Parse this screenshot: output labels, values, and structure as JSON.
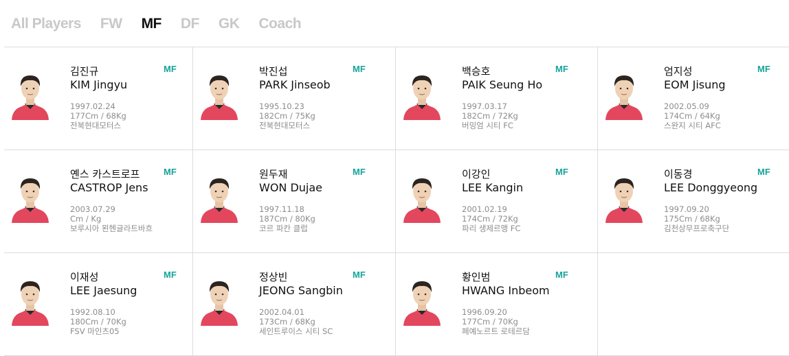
{
  "tabs": [
    "All Players",
    "FW",
    "MF",
    "DF",
    "GK",
    "Coach"
  ],
  "active_tab": "MF",
  "colors": {
    "accent": "#16a39a",
    "active_tab": "#111111",
    "inactive_tab": "#c8c8c8",
    "jersey": "#e3475d"
  },
  "players": [
    {
      "name_kr": "김진규",
      "name_en": "KIM Jingyu",
      "position": "MF",
      "birth": "1997.02.24",
      "body": "177Cm / 68Kg",
      "club": "전북현대모터스"
    },
    {
      "name_kr": "박진섭",
      "name_en": "PARK Jinseob",
      "position": "MF",
      "birth": "1995.10.23",
      "body": "182Cm / 75Kg",
      "club": "전북현대모터스"
    },
    {
      "name_kr": "백승호",
      "name_en": "PAIK Seung Ho",
      "position": "MF",
      "birth": "1997.03.17",
      "body": "182Cm / 72Kg",
      "club": "버밍엄 시티 FC"
    },
    {
      "name_kr": "엄지성",
      "name_en": "EOM Jisung",
      "position": "MF",
      "birth": "2002.05.09",
      "body": "174Cm / 64Kg",
      "club": "스완지 시티 AFC"
    },
    {
      "name_kr": "옌스 카스트로프",
      "name_en": "CASTROP Jens",
      "position": "MF",
      "birth": "2003.07.29",
      "body": "Cm / Kg",
      "club": "보루시아 묀헨글라트바흐"
    },
    {
      "name_kr": "원두재",
      "name_en": "WON Dujae",
      "position": "MF",
      "birth": "1997.11.18",
      "body": "187Cm / 80Kg",
      "club": "코르 파칸 클럽"
    },
    {
      "name_kr": "이강인",
      "name_en": "LEE Kangin",
      "position": "MF",
      "birth": "2001.02.19",
      "body": "174Cm / 72Kg",
      "club": "파리 생제르맹 FC"
    },
    {
      "name_kr": "이동경",
      "name_en": "LEE Donggyeong",
      "position": "MF",
      "birth": "1997.09.20",
      "body": "175Cm / 68Kg",
      "club": "김천상무프로축구단"
    },
    {
      "name_kr": "이재성",
      "name_en": "LEE Jaesung",
      "position": "MF",
      "birth": "1992.08.10",
      "body": "180Cm / 70Kg",
      "club": "FSV 마인츠05"
    },
    {
      "name_kr": "정상빈",
      "name_en": "JEONG Sangbin",
      "position": "MF",
      "birth": "2002.04.01",
      "body": "173Cm / 68Kg",
      "club": "세인트루이스 시티 SC"
    },
    {
      "name_kr": "황인범",
      "name_en": "HWANG Inbeom",
      "position": "MF",
      "birth": "1996.09.20",
      "body": "177Cm / 70Kg",
      "club": "페예노르트 로테르담"
    }
  ]
}
